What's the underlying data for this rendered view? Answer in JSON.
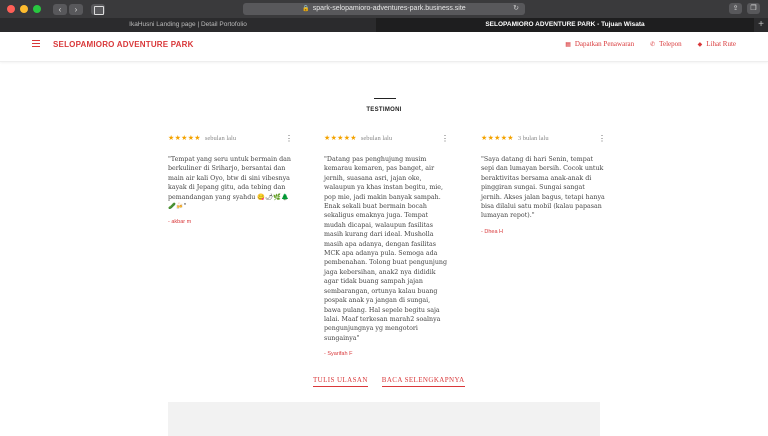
{
  "browser": {
    "url": "spark-selopamioro-adventures-park.business.site",
    "tabs": [
      {
        "label": "IkaHusni Landing page | Detail Portofolio"
      },
      {
        "label": "SELOPAMIORO ADVENTURE PARK - Tujuan Wisata"
      }
    ],
    "colors": {
      "close": "#ff5f57",
      "minimize": "#febc2e",
      "maximize": "#28c840"
    }
  },
  "header": {
    "brand": "SELOPAMIORO ADVENTURE PARK",
    "links": [
      {
        "label": "Dapatkan Penawaran",
        "icon": "offer-icon"
      },
      {
        "label": "Telepon",
        "icon": "phone-icon"
      },
      {
        "label": "Lihat Rute",
        "icon": "directions-icon"
      }
    ],
    "accent": "#d9383a"
  },
  "section": {
    "title": "TESTIMONI"
  },
  "reviews": [
    {
      "stars": "★★★★★",
      "time": "sebulan lalu",
      "text": "\"Tempat yang seru untuk bermain dan berkuliner di Sriharjo, bersantai dan main air kali Oyo, btw di sini vibesnya kayak di Jepang gitu, ada tebing dan pemandangan yang syahdu 😋🌶🌿🌲🥒🍻\"",
      "author": "- akbar m"
    },
    {
      "stars": "★★★★★",
      "time": "sebulan lalu",
      "text": "\"Datang pas penghujung musim kemarau kemaren, pas banget, air jernih, suasana asri, jajan oke, walaupun ya khas instan begitu, mie, pop mie, jadi makin banyak sampah. Enak sekali buat bermain bocah sekaligus emaknya juga. Tempat mudah dicapai, walaupun fasilitas masih kurang dari ideal. Musholla masih apa adanya, dengan fasilitas MCK apa adanya pula. Semoga ada pembenahan. Tolong buat pengunjung jaga kebersihan, anak2 nya dididik agar tidak buang sampah jajan sembarangan, ortunya kalau buang pospak anak ya jangan di sungai, bawa pulang. Hal sepele begitu saja lalai. Maaf terkesan marah2 soalnya pengunjungnya yg mengotori sungainya\"",
      "author": "- Syarifah F"
    },
    {
      "stars": "★★★★★",
      "time": "3 bulan lalu",
      "text": "\"Saya datang di hari Senin, tempat sepi dan lumayan bersih. Cocok untuk beraktivitas bersama anak-anak di pinggiran sungai. Sungai sangat jernih. Akses jalan bagus, tetapi hanya bisa dilalui satu mobil (kalau papasan lumayan repot).\"",
      "author": "- Dhea H"
    }
  ],
  "actions": {
    "write_review": "TULIS ULASAN",
    "read_more": "BACA SELENGKAPNYA"
  }
}
